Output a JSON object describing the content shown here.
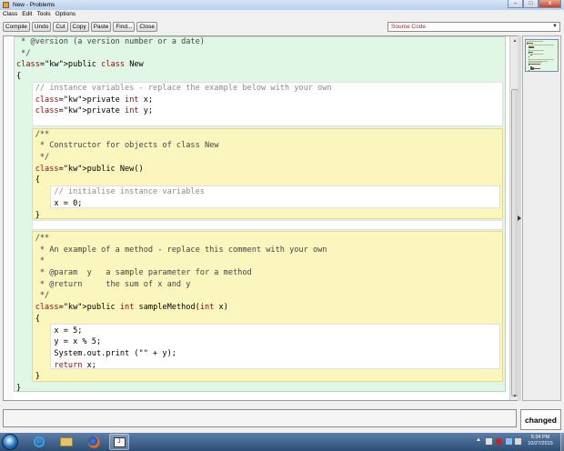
{
  "window": {
    "title": "New - Problems",
    "min_label": "–",
    "max_label": "□",
    "close_label": "x"
  },
  "menu": [
    "Class",
    "Edit",
    "Tools",
    "Options"
  ],
  "toolbar": {
    "buttons": [
      "Compile",
      "Undo",
      "Cut",
      "Copy",
      "Paste",
      "Find...",
      "Close"
    ]
  },
  "view_select": {
    "value": "Source Code"
  },
  "code": {
    "lines": [
      " * @version (a version number or a date)",
      " */",
      "public class New",
      "{",
      "    // instance variables - replace the example below with your own",
      "    private int x;",
      "    private int y;",
      "",
      "    /**",
      "     * Constructor for objects of class New",
      "     */",
      "    public New()",
      "    {",
      "        // initialise instance variables",
      "        x = 0;",
      "    }",
      "",
      "    /**",
      "     * An example of a method - replace this comment with your own",
      "     *",
      "     * @param  y   a sample parameter for a method",
      "     * @return     the sum of x and y",
      "     */",
      "    public int sampleMethod(int x)",
      "    {",
      "        x = 5;",
      "        y = x % 5;",
      "        System.out.print (\"\" + y);",
      "        return x;",
      "    }",
      "}"
    ]
  },
  "status": {
    "message": "",
    "changed_label": "changed"
  },
  "taskbar": {
    "clock_time": "5:34 PM",
    "clock_date": "10/27/2015"
  },
  "colors": {
    "class_scope": "#e0f7e6",
    "method_scope": "#fbf6be",
    "keyword": "#8b0a0a",
    "comment": "#8a8a8a"
  }
}
